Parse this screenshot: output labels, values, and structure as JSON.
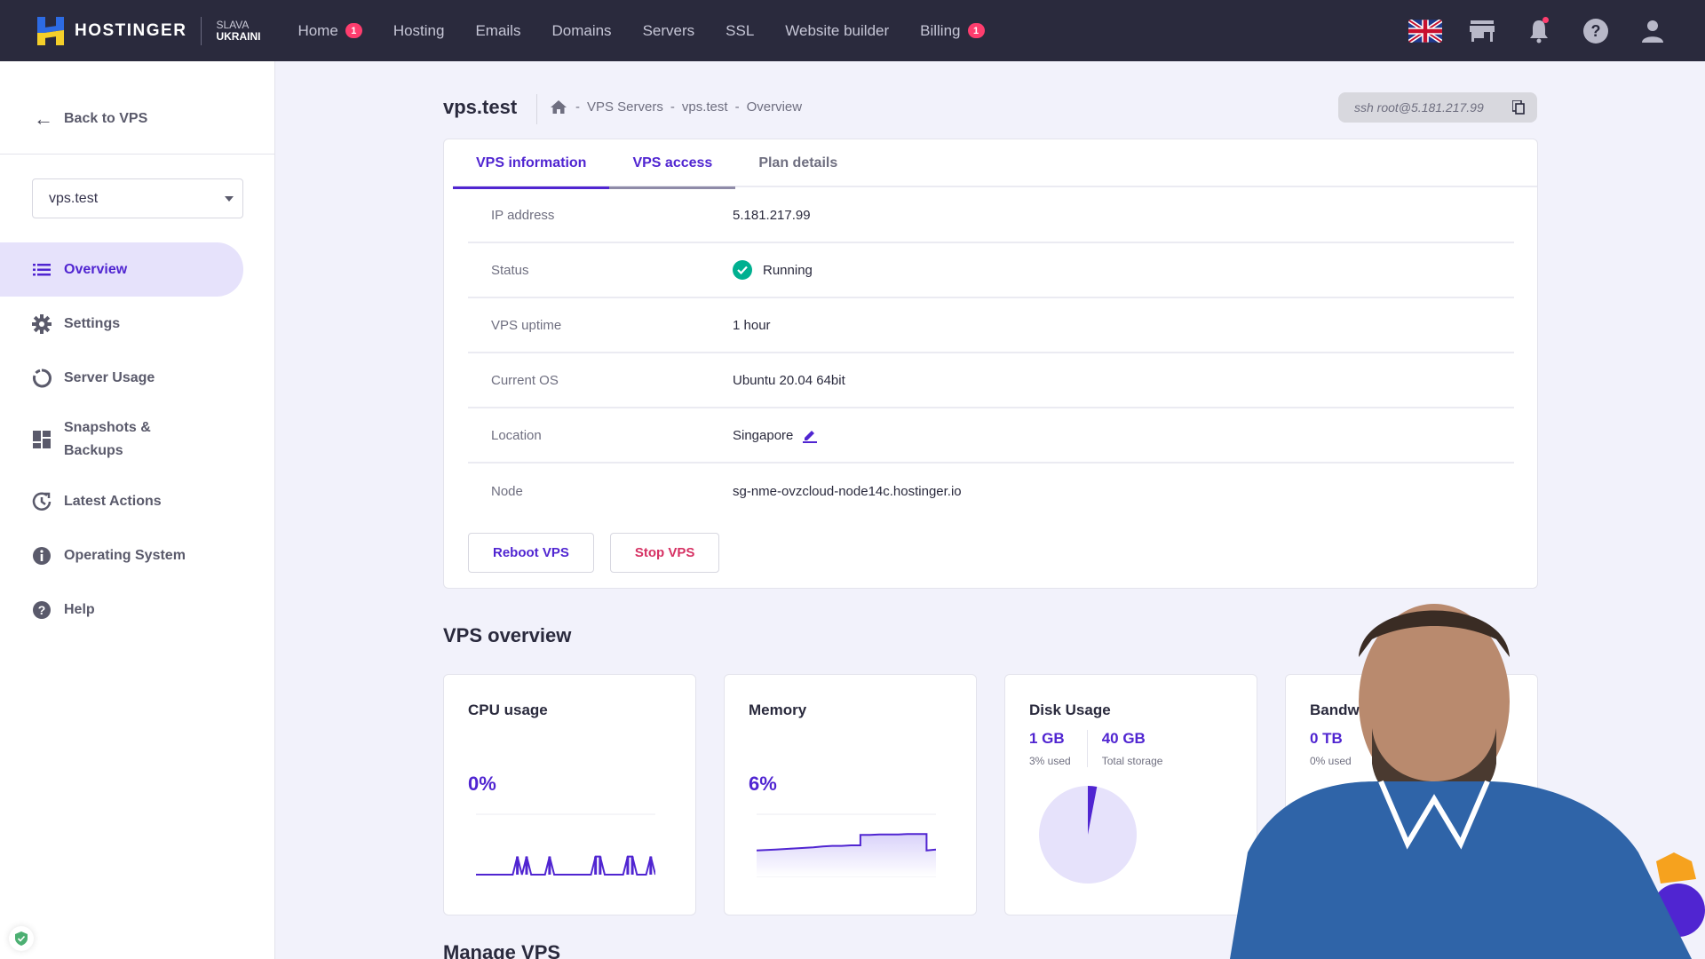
{
  "topbar": {
    "brand": "HOSTINGER",
    "slava_line1": "SLAVA",
    "slava_line2": "UKRAINI",
    "nav": [
      {
        "label": "Home",
        "badge": "1"
      },
      {
        "label": "Hosting"
      },
      {
        "label": "Emails"
      },
      {
        "label": "Domains"
      },
      {
        "label": "Servers"
      },
      {
        "label": "SSL"
      },
      {
        "label": "Website builder"
      },
      {
        "label": "Billing",
        "badge": "1"
      }
    ],
    "icons": [
      "uk-flag-icon",
      "store-icon",
      "bell-icon",
      "help-icon",
      "user-icon"
    ]
  },
  "sidebar": {
    "back_label": "Back to VPS",
    "server_select": "vps.test",
    "items": [
      {
        "label": "Overview",
        "icon": "list-icon",
        "active": true
      },
      {
        "label": "Settings",
        "icon": "gear-icon"
      },
      {
        "label": "Server Usage",
        "icon": "circle-progress-icon"
      },
      {
        "label": "Snapshots &",
        "label2": "Backups",
        "icon": "dashboard-grid-icon"
      },
      {
        "label": "Latest Actions",
        "icon": "history-icon"
      },
      {
        "label": "Operating System",
        "icon": "info-icon"
      },
      {
        "label": "Help",
        "icon": "help-icon"
      }
    ]
  },
  "header": {
    "title": "vps.test",
    "breadcrumb": [
      "-",
      "VPS Servers",
      "-",
      "vps.test",
      "-",
      "Overview"
    ],
    "ssh_command": "ssh root@5.181.217.99"
  },
  "info": {
    "tabs": [
      {
        "label": "VPS information",
        "state": "active"
      },
      {
        "label": "VPS access",
        "state": "hover"
      },
      {
        "label": "Plan details",
        "state": ""
      }
    ],
    "rows": [
      {
        "key": "IP address",
        "value": "5.181.217.99"
      },
      {
        "key": "Status",
        "value": "Running"
      },
      {
        "key": "VPS uptime",
        "value": "1 hour"
      },
      {
        "key": "Current OS",
        "value": "Ubuntu 20.04 64bit"
      },
      {
        "key": "Location",
        "value": "Singapore"
      },
      {
        "key": "Node",
        "value": "sg-nme-ovzcloud-node14c.hostinger.io"
      }
    ],
    "reboot_label": "Reboot VPS",
    "stop_label": "Stop VPS"
  },
  "overview": {
    "title": "VPS overview",
    "cpu": {
      "title": "CPU usage",
      "value": "0%"
    },
    "memory": {
      "title": "Memory",
      "value": "6%"
    },
    "disk": {
      "title": "Disk Usage",
      "used": "1 GB",
      "used_label": "3% used",
      "total": "40 GB",
      "total_label": "Total storage",
      "used_fraction": 0.03
    },
    "bandwidth": {
      "title": "Bandw",
      "value": "0 TB",
      "used_label": "0% used"
    }
  },
  "manage_title": "Manage VPS",
  "colors": {
    "primary": "#5025d1",
    "danger": "#d63163",
    "success": "#00b090",
    "badge": "#ff3d6e",
    "topbar": "#2a2a3d"
  },
  "chart_data": [
    {
      "type": "line",
      "title": "CPU usage",
      "ylim": [
        0,
        100
      ],
      "x": [
        0,
        1,
        2,
        3,
        4,
        5,
        6,
        7,
        8,
        9,
        10,
        11,
        12,
        13,
        14,
        15,
        16,
        17,
        18,
        19,
        20,
        21,
        22,
        23,
        24,
        25,
        26,
        27,
        28,
        29,
        30,
        31,
        32,
        33,
        34,
        35,
        36,
        37,
        38,
        39
      ],
      "values": [
        0,
        0,
        0,
        0,
        0,
        0,
        0,
        0,
        0,
        6,
        0,
        6,
        0,
        0,
        0,
        0,
        6,
        0,
        0,
        0,
        0,
        0,
        0,
        0,
        0,
        0,
        6,
        6,
        0,
        0,
        0,
        0,
        0,
        6,
        6,
        0,
        0,
        0,
        6,
        0
      ]
    },
    {
      "type": "area",
      "title": "Memory",
      "ylim": [
        0,
        12
      ],
      "x": [
        0,
        1,
        2,
        3,
        4,
        5,
        6,
        7,
        8,
        9,
        10,
        11,
        12,
        13,
        14,
        15,
        16,
        17,
        18,
        19
      ],
      "values": [
        5.0,
        5.1,
        5.2,
        5.3,
        5.4,
        5.5,
        5.6,
        5.8,
        5.9,
        5.9,
        6.0,
        8.0,
        8.0,
        8.1,
        8.1,
        8.1,
        8.2,
        8.2,
        5.0,
        5.2
      ]
    },
    {
      "type": "pie",
      "title": "Disk Usage",
      "categories": [
        "Used",
        "Free"
      ],
      "values": [
        3,
        97
      ]
    }
  ]
}
